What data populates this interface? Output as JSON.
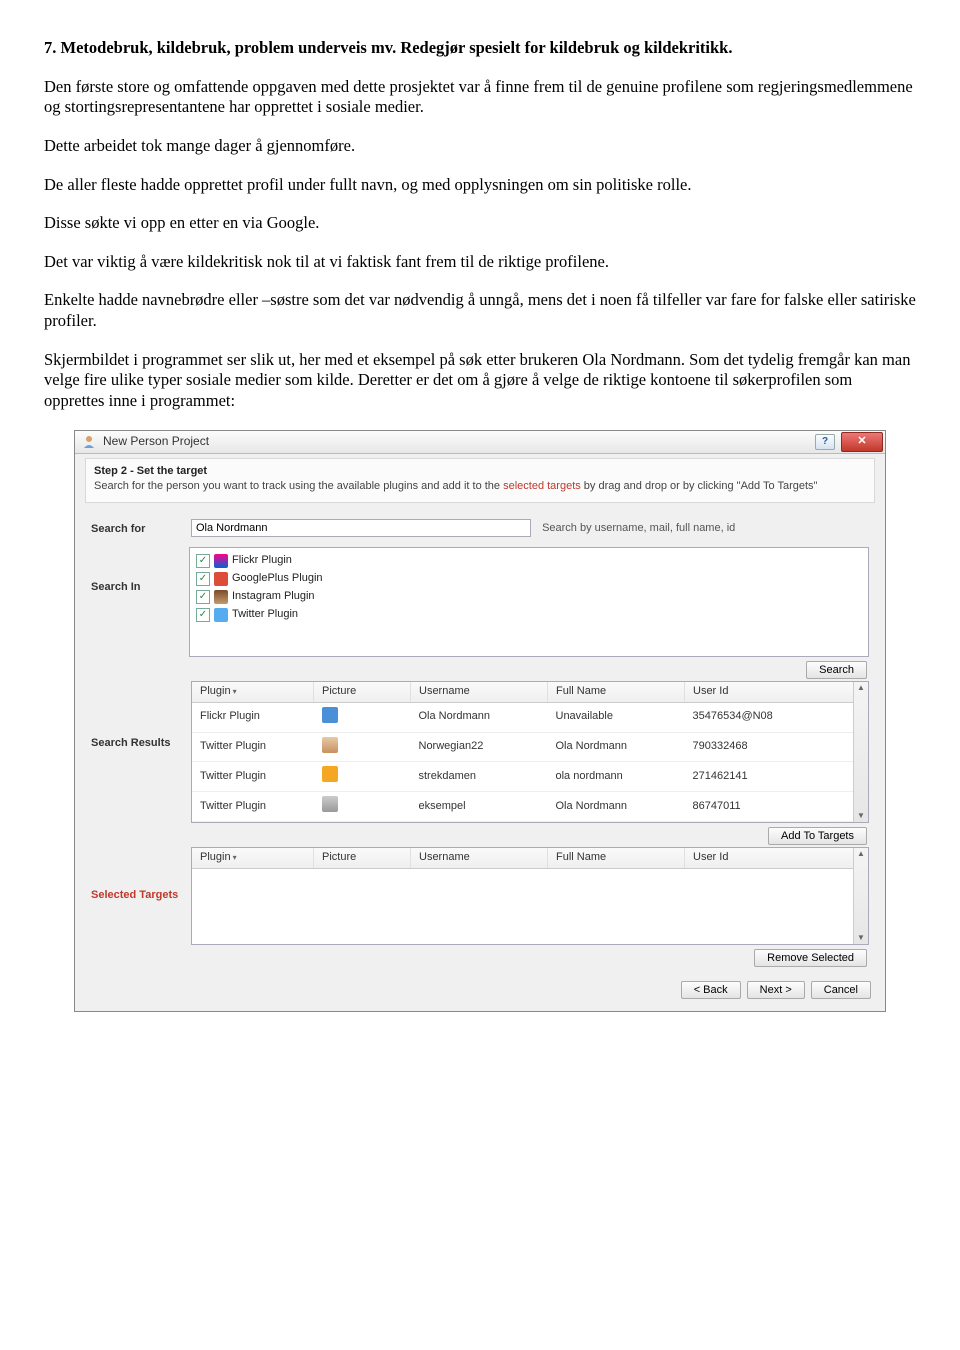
{
  "doc": {
    "heading": "7. Metodebruk, kildebruk, problem underveis mv. Redegjør spesielt for kildebruk og kildekritikk.",
    "p1": "Den første store og omfattende oppgaven med dette prosjektet var å finne frem til de genuine profilene som regjeringsmedlemmene og stortingsrepresentantene har opprettet i sosiale medier.",
    "p2": "Dette arbeidet tok mange dager å gjennomføre.",
    "p3": "De aller fleste hadde opprettet profil under fullt navn, og med opplysningen om sin politiske rolle.",
    "p4": "Disse søkte vi opp en etter en via Google.",
    "p5": "Det var viktig å være kildekritisk nok til at vi faktisk fant frem til de riktige profilene.",
    "p6": "Enkelte hadde navnebrødre eller –søstre som det var nødvendig å unngå, mens det i noen få tilfeller var fare for falske eller satiriske profiler.",
    "p7": "Skjermbildet i programmet ser slik ut, her med et eksempel på søk etter brukeren Ola Nordmann. Som det tydelig fremgår kan man velge fire ulike typer sosiale medier som kilde. Deretter er det om å gjøre å velge de riktige kontoene til søkerprofilen som opprettes inne i programmet:"
  },
  "win": {
    "title": "New Person Project",
    "help": "?",
    "close": "✕",
    "step_title": "Step 2 - Set the target",
    "step_desc_pre": "Search for the person you want to track using the available plugins and add it to the ",
    "step_desc_accent": "selected targets",
    "step_desc_post": " by drag and drop or by clicking \"Add To Targets\"",
    "labels": {
      "search_for": "Search for",
      "search_in": "Search In",
      "search_results": "Search Results",
      "selected_targets": "Selected Targets"
    },
    "search_value": "Ola Nordmann",
    "search_hint": "Search by username, mail, full name, id",
    "plugins": [
      "Flickr Plugin",
      "GooglePlus Plugin",
      "Instagram Plugin",
      "Twitter Plugin"
    ],
    "buttons": {
      "search": "Search",
      "add": "Add To Targets",
      "remove": "Remove Selected",
      "back": "< Back",
      "next": "Next >",
      "cancel": "Cancel"
    },
    "columns": {
      "plugin": "Plugin",
      "picture": "Picture",
      "username": "Username",
      "fullname": "Full Name",
      "userid": "User Id"
    },
    "results": [
      {
        "plugin": "Flickr Plugin",
        "avatar": "av-blue",
        "username": "Ola Nordmann",
        "fullname": "Unavailable",
        "userid": "35476534@N08"
      },
      {
        "plugin": "Twitter Plugin",
        "avatar": "av-person",
        "username": "Norwegian22",
        "fullname": "Ola Nordmann",
        "userid": "790332468"
      },
      {
        "plugin": "Twitter Plugin",
        "avatar": "av-orange",
        "username": "strekdamen",
        "fullname": "ola nordmann",
        "userid": "271462141"
      },
      {
        "plugin": "Twitter Plugin",
        "avatar": "av-gray",
        "username": "eksempel",
        "fullname": "Ola Nordmann",
        "userid": "86747011"
      }
    ]
  }
}
